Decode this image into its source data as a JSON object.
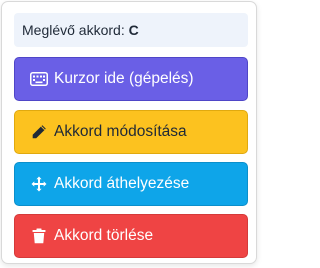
{
  "existing_chord": {
    "label": "Meglévő akkord:",
    "value": "C"
  },
  "buttons": {
    "cursor": {
      "label": "Kurzor ide (gépelés)",
      "icon": "keyboard-icon"
    },
    "edit": {
      "label": "Akkord módosítása",
      "icon": "pencil-icon"
    },
    "move": {
      "label": "Akkord áthelyezése",
      "icon": "move-arrows-icon"
    },
    "delete": {
      "label": "Akkord törlése",
      "icon": "trash-icon"
    }
  },
  "colors": {
    "cursor": "#6a5fe6",
    "edit": "#fcc21f",
    "move": "#0ea5e9",
    "delete": "#ef4444"
  }
}
